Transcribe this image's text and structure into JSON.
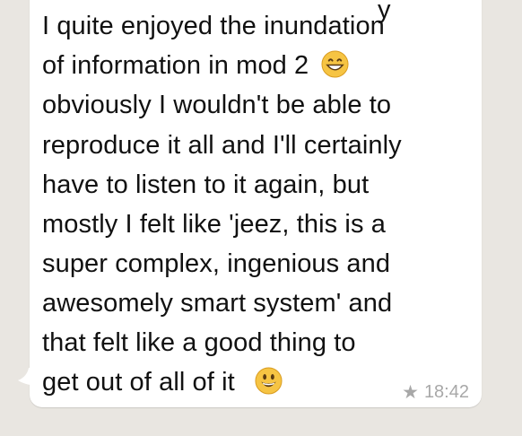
{
  "message": {
    "lines": [
      "I quite enjoyed the inundation",
      "of information in mod 2",
      "obviously I wouldn't be able to",
      "reproduce it all and I'll certainly",
      "have to listen to it again, but",
      "mostly I felt like 'jeez, this is a",
      "super complex, ingenious and",
      "awesomely smart system' and",
      "that felt like a good thing to",
      "get out of all of it"
    ],
    "emojis": [
      "grinning-face-icon",
      "smiling-face-icon"
    ],
    "time": "18:42",
    "starred": true
  },
  "colors": {
    "background": "#e9e6e1",
    "bubble": "#ffffff",
    "text": "#111111",
    "meta": "#a8a8a8",
    "emoji_face": "#f6c443"
  }
}
